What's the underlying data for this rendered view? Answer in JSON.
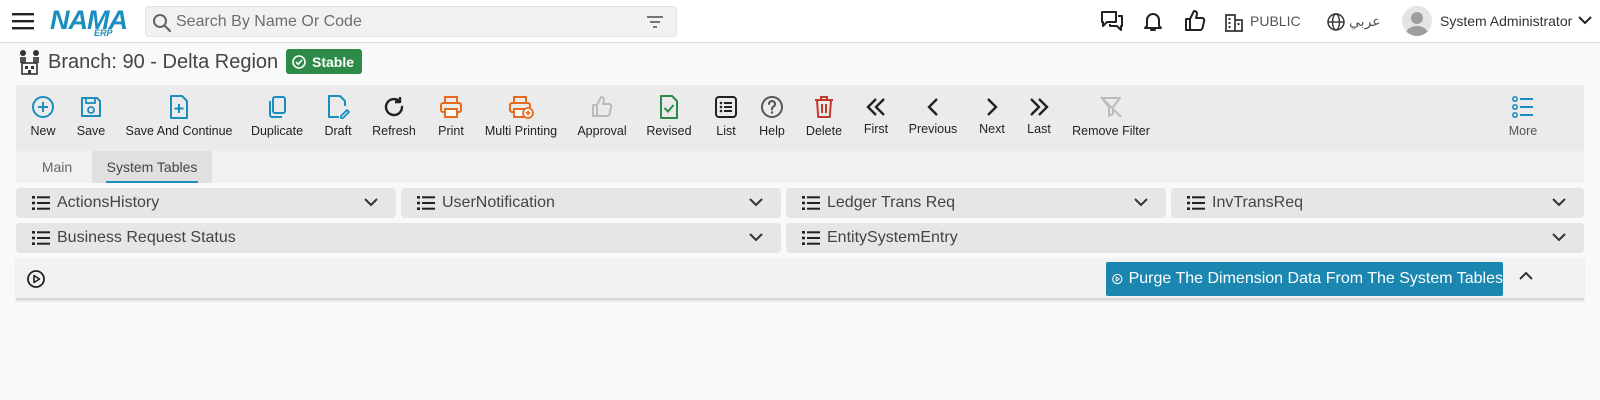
{
  "app": {
    "logo_text": "NAMA",
    "logo_sub": "ERP"
  },
  "search": {
    "placeholder": "Search By Name Or Code"
  },
  "topbar": {
    "company_label": "PUBLIC",
    "language_label": "عربي",
    "user_name": "System Administrator"
  },
  "page": {
    "title": "Branch: 90 - Delta Region",
    "status_badge": "Stable"
  },
  "toolbar": {
    "buttons": [
      {
        "label": "New",
        "icon": "plus-circle-icon",
        "color": "#1a8fbf"
      },
      {
        "label": "Save",
        "icon": "save-icon",
        "color": "#1a8fbf"
      },
      {
        "label": "Save And Continue",
        "icon": "file-plus-icon",
        "color": "#1a8fbf"
      },
      {
        "label": "Duplicate",
        "icon": "copy-icon",
        "color": "#1a8fbf"
      },
      {
        "label": "Draft",
        "icon": "file-edit-icon",
        "color": "#1a8fbf"
      },
      {
        "label": "Refresh",
        "icon": "refresh-icon",
        "color": "#222222"
      },
      {
        "label": "Print",
        "icon": "printer-icon",
        "color": "#e86a1c"
      },
      {
        "label": "Multi Printing",
        "icon": "multi-printer-icon",
        "color": "#e86a1c"
      },
      {
        "label": "Approval",
        "icon": "thumbs-up-icon",
        "color": "#bbbbbb"
      },
      {
        "label": "Revised",
        "icon": "file-check-icon",
        "color": "#2e8b47"
      },
      {
        "label": "List",
        "icon": "list-icon",
        "color": "#222222"
      },
      {
        "label": "Help",
        "icon": "help-circle-icon",
        "color": "#555555"
      },
      {
        "label": "Delete",
        "icon": "trash-icon",
        "color": "#c0392b"
      },
      {
        "label": "First",
        "icon": "double-chevron-left-icon",
        "color": "#222222"
      },
      {
        "label": "Previous",
        "icon": "chevron-left-icon",
        "color": "#222222"
      },
      {
        "label": "Next",
        "icon": "chevron-right-icon",
        "color": "#222222"
      },
      {
        "label": "Last",
        "icon": "double-chevron-right-icon",
        "color": "#222222"
      },
      {
        "label": "Remove Filter",
        "icon": "filter-off-icon",
        "color": "#bbbbbb"
      },
      {
        "label": "More",
        "icon": "more-list-icon",
        "color": "#1a8fbf"
      }
    ]
  },
  "tabs": [
    {
      "label": "Main",
      "active": false
    },
    {
      "label": "System Tables",
      "active": true
    }
  ],
  "accordions": [
    {
      "label": "ActionsHistory"
    },
    {
      "label": "UserNotification"
    },
    {
      "label": "Ledger Trans Req"
    },
    {
      "label": "InvTransReq"
    },
    {
      "label": "Business Request Status"
    },
    {
      "label": "EntitySystemEntry"
    }
  ],
  "actions": {
    "purge_label": "Purge The Dimension Data From The System Tables"
  },
  "colors": {
    "accent": "#1a8fbf",
    "status_green": "#2e8b47",
    "purge_button": "#1b87b0"
  }
}
